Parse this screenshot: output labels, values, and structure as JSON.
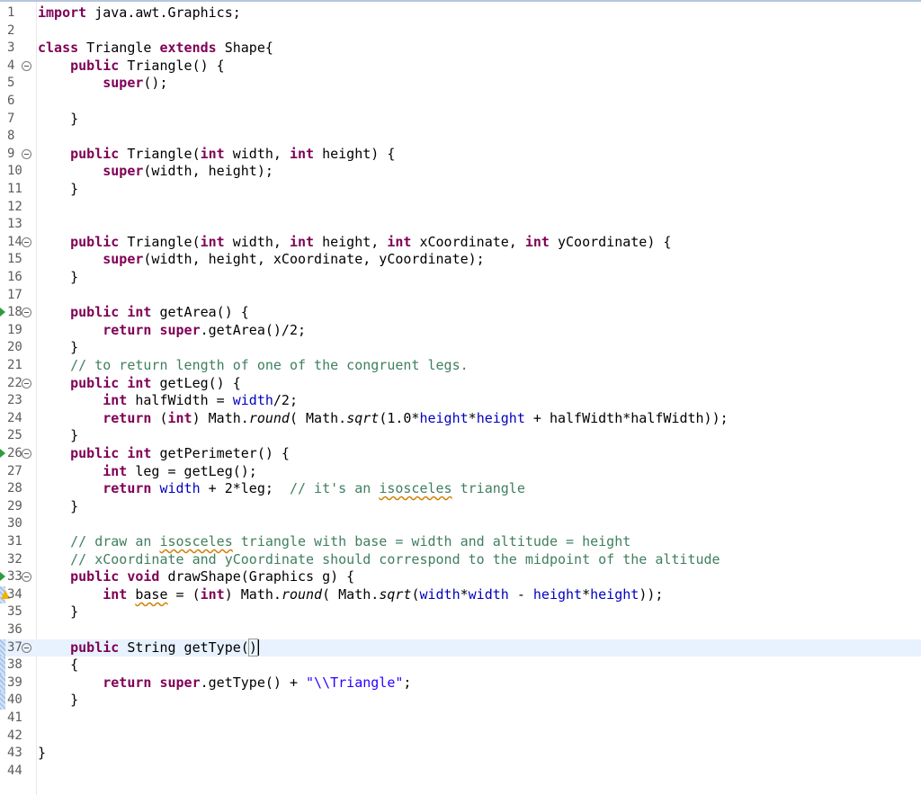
{
  "editor": {
    "language": "java",
    "current_line": 37,
    "lines": [
      {
        "n": "1",
        "tokens": [
          [
            "kw",
            "import"
          ],
          [
            "t",
            " java.awt.Graphics;"
          ]
        ]
      },
      {
        "n": "2",
        "tokens": []
      },
      {
        "n": "3",
        "tokens": [
          [
            "kw",
            "class"
          ],
          [
            "t",
            " Triangle "
          ],
          [
            "kw",
            "extends"
          ],
          [
            "t",
            " Shape{"
          ]
        ]
      },
      {
        "n": "4",
        "fold": true,
        "tokens": [
          [
            "t",
            "    "
          ],
          [
            "kw",
            "public"
          ],
          [
            "t",
            " Triangle() {"
          ]
        ]
      },
      {
        "n": "5",
        "tokens": [
          [
            "t",
            "        "
          ],
          [
            "kw",
            "super"
          ],
          [
            "t",
            "();"
          ]
        ]
      },
      {
        "n": "6",
        "tokens": []
      },
      {
        "n": "7",
        "tokens": [
          [
            "t",
            "    }"
          ]
        ]
      },
      {
        "n": "8",
        "tokens": []
      },
      {
        "n": "9",
        "fold": true,
        "tokens": [
          [
            "t",
            "    "
          ],
          [
            "kw",
            "public"
          ],
          [
            "t",
            " Triangle("
          ],
          [
            "kw",
            "int"
          ],
          [
            "t",
            " width, "
          ],
          [
            "kw",
            "int"
          ],
          [
            "t",
            " height) {"
          ]
        ]
      },
      {
        "n": "10",
        "tokens": [
          [
            "t",
            "        "
          ],
          [
            "kw",
            "super"
          ],
          [
            "t",
            "(width, height);"
          ]
        ]
      },
      {
        "n": "11",
        "tokens": [
          [
            "t",
            "    }"
          ]
        ]
      },
      {
        "n": "12",
        "tokens": []
      },
      {
        "n": "13",
        "tokens": []
      },
      {
        "n": "14",
        "fold": true,
        "tokens": [
          [
            "t",
            "    "
          ],
          [
            "kw",
            "public"
          ],
          [
            "t",
            " Triangle("
          ],
          [
            "kw",
            "int"
          ],
          [
            "t",
            " width, "
          ],
          [
            "kw",
            "int"
          ],
          [
            "t",
            " height, "
          ],
          [
            "kw",
            "int"
          ],
          [
            "t",
            " xCoordinate, "
          ],
          [
            "kw",
            "int"
          ],
          [
            "t",
            " yCoordinate) {"
          ]
        ]
      },
      {
        "n": "15",
        "tokens": [
          [
            "t",
            "        "
          ],
          [
            "kw",
            "super"
          ],
          [
            "t",
            "(width, height, xCoordinate, yCoordinate);"
          ]
        ]
      },
      {
        "n": "16",
        "tokens": [
          [
            "t",
            "    }"
          ]
        ]
      },
      {
        "n": "17",
        "tokens": []
      },
      {
        "n": "18",
        "fold": true,
        "override": true,
        "tokens": [
          [
            "t",
            "    "
          ],
          [
            "kw",
            "public"
          ],
          [
            "t",
            " "
          ],
          [
            "kw",
            "int"
          ],
          [
            "t",
            " getArea() {"
          ]
        ]
      },
      {
        "n": "19",
        "tokens": [
          [
            "t",
            "        "
          ],
          [
            "kw",
            "return"
          ],
          [
            "t",
            " "
          ],
          [
            "kw",
            "super"
          ],
          [
            "t",
            ".getArea()/2;"
          ]
        ]
      },
      {
        "n": "20",
        "tokens": [
          [
            "t",
            "    }"
          ]
        ]
      },
      {
        "n": "21",
        "tokens": [
          [
            "t",
            "    "
          ],
          [
            "cm",
            "// to return length of one of the congruent legs."
          ]
        ]
      },
      {
        "n": "22",
        "fold": true,
        "tokens": [
          [
            "t",
            "    "
          ],
          [
            "kw",
            "public"
          ],
          [
            "t",
            " "
          ],
          [
            "kw",
            "int"
          ],
          [
            "t",
            " getLeg() {"
          ]
        ]
      },
      {
        "n": "23",
        "tokens": [
          [
            "t",
            "        "
          ],
          [
            "kw",
            "int"
          ],
          [
            "t",
            " halfWidth = "
          ],
          [
            "fld",
            "width"
          ],
          [
            "t",
            "/2;"
          ]
        ]
      },
      {
        "n": "24",
        "tokens": [
          [
            "t",
            "        "
          ],
          [
            "kw",
            "return"
          ],
          [
            "t",
            " ("
          ],
          [
            "kw",
            "int"
          ],
          [
            "t",
            ") Math."
          ],
          [
            "it",
            "round"
          ],
          [
            "t",
            "( Math."
          ],
          [
            "it",
            "sqrt"
          ],
          [
            "t",
            "(1.0*"
          ],
          [
            "fld",
            "height"
          ],
          [
            "t",
            "*"
          ],
          [
            "fld",
            "height"
          ],
          [
            "t",
            " + halfWidth*halfWidth));"
          ]
        ]
      },
      {
        "n": "25",
        "tokens": [
          [
            "t",
            "    }"
          ]
        ]
      },
      {
        "n": "26",
        "fold": true,
        "override": true,
        "tokens": [
          [
            "t",
            "    "
          ],
          [
            "kw",
            "public"
          ],
          [
            "t",
            " "
          ],
          [
            "kw",
            "int"
          ],
          [
            "t",
            " getPerimeter() {"
          ]
        ]
      },
      {
        "n": "27",
        "tokens": [
          [
            "t",
            "        "
          ],
          [
            "kw",
            "int"
          ],
          [
            "t",
            " leg = getLeg();"
          ]
        ]
      },
      {
        "n": "28",
        "tokens": [
          [
            "t",
            "        "
          ],
          [
            "kw",
            "return"
          ],
          [
            "t",
            " "
          ],
          [
            "fld",
            "width"
          ],
          [
            "t",
            " + 2*leg;  "
          ],
          [
            "cm",
            "// it's an "
          ],
          [
            "cmsq",
            "isosceles"
          ],
          [
            "cm",
            " triangle"
          ]
        ]
      },
      {
        "n": "29",
        "tokens": [
          [
            "t",
            "    }"
          ]
        ]
      },
      {
        "n": "30",
        "tokens": []
      },
      {
        "n": "31",
        "tokens": [
          [
            "t",
            "    "
          ],
          [
            "cm",
            "// draw an "
          ],
          [
            "cmsq",
            "isosceles"
          ],
          [
            "cm",
            " triangle with base = width and altitude = height"
          ]
        ]
      },
      {
        "n": "32",
        "tokens": [
          [
            "t",
            "    "
          ],
          [
            "cm",
            "// xCoordinate and yCoordinate should correspond to the midpoint of the altitude"
          ]
        ]
      },
      {
        "n": "33",
        "fold": true,
        "override": true,
        "tokens": [
          [
            "t",
            "    "
          ],
          [
            "kw",
            "public"
          ],
          [
            "t",
            " "
          ],
          [
            "kw",
            "void"
          ],
          [
            "t",
            " drawShape(Graphics g) {"
          ]
        ]
      },
      {
        "n": "34",
        "warn": true,
        "qdiff": true,
        "tokens": [
          [
            "t",
            "        "
          ],
          [
            "kw",
            "int"
          ],
          [
            "t",
            " "
          ],
          [
            "sq",
            "base"
          ],
          [
            "t",
            " = ("
          ],
          [
            "kw",
            "int"
          ],
          [
            "t",
            ") Math."
          ],
          [
            "it",
            "round"
          ],
          [
            "t",
            "( Math."
          ],
          [
            "it",
            "sqrt"
          ],
          [
            "t",
            "("
          ],
          [
            "fld",
            "width"
          ],
          [
            "t",
            "*"
          ],
          [
            "fld",
            "width"
          ],
          [
            "t",
            " - "
          ],
          [
            "fld",
            "height"
          ],
          [
            "t",
            "*"
          ],
          [
            "fld",
            "height"
          ],
          [
            "t",
            "));"
          ]
        ]
      },
      {
        "n": "35",
        "tokens": [
          [
            "t",
            "    }"
          ]
        ]
      },
      {
        "n": "36",
        "tokens": []
      },
      {
        "n": "37",
        "fold": true,
        "qdiff": true,
        "highlight": true,
        "tokens": [
          [
            "t",
            "    "
          ],
          [
            "kw",
            "public"
          ],
          [
            "t",
            " String getType("
          ],
          [
            "br",
            ")"
          ],
          [
            "caret",
            ""
          ]
        ]
      },
      {
        "n": "38",
        "qdiff": true,
        "tokens": [
          [
            "t",
            "    {"
          ]
        ]
      },
      {
        "n": "39",
        "qdiff": true,
        "tokens": [
          [
            "t",
            "        "
          ],
          [
            "kw",
            "return"
          ],
          [
            "t",
            " "
          ],
          [
            "kw",
            "super"
          ],
          [
            "t",
            ".getType() + "
          ],
          [
            "str",
            "\"\\\\Triangle\""
          ],
          [
            "t",
            ";"
          ]
        ]
      },
      {
        "n": "40",
        "qdiff": true,
        "tokens": [
          [
            "t",
            "    }"
          ]
        ]
      },
      {
        "n": "41",
        "tokens": []
      },
      {
        "n": "42",
        "tokens": []
      },
      {
        "n": "43",
        "tokens": [
          [
            "t",
            "}"
          ]
        ]
      },
      {
        "n": "44",
        "tokens": []
      }
    ]
  }
}
